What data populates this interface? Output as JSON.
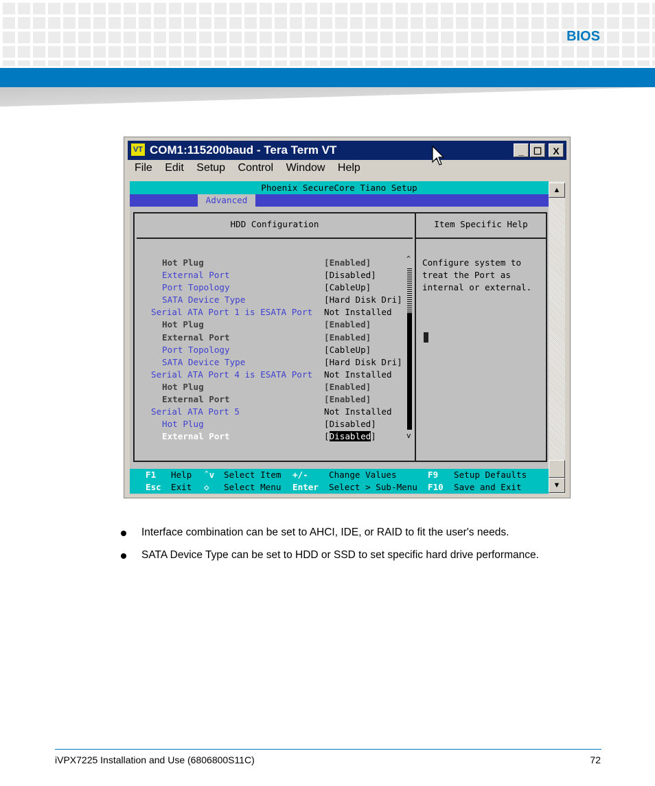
{
  "header": {
    "section": "BIOS"
  },
  "window": {
    "title": "COM1:115200baud - Tera Term VT",
    "icon": "VT",
    "menu": [
      "File",
      "Edit",
      "Setup",
      "Control",
      "Window",
      "Help"
    ],
    "controls": {
      "minimize": "_",
      "maximize": "☐",
      "close": "X"
    }
  },
  "bios": {
    "banner": "Phoenix SecureCore Tiano Setup",
    "tab": "Advanced",
    "panel_title": "HDD Configuration",
    "help_title": "Item Specific Help",
    "help_text": [
      "Configure system to",
      "treat the Port as",
      "internal or external."
    ],
    "rows": [
      {
        "label": "Hot Plug",
        "value": "[Enabled]",
        "style": "gray",
        "indent": true
      },
      {
        "label": "External Port",
        "value": "[Disabled]",
        "style": "blue",
        "indent": true
      },
      {
        "label": "Port Topology",
        "value": "[CableUp]",
        "style": "blue",
        "indent": true
      },
      {
        "label": "SATA Device Type",
        "value": "[Hard Disk Dri]",
        "style": "blue",
        "indent": true
      },
      {
        "label": "Serial ATA Port 1 is ESATA Port",
        "value": "Not Installed",
        "style": "blue",
        "indent": false
      },
      {
        "label": "Hot Plug",
        "value": "[Enabled]",
        "style": "gray",
        "indent": true
      },
      {
        "label": "External Port",
        "value": "[Enabled]",
        "style": "gray",
        "indent": true
      },
      {
        "label": "Port Topology",
        "value": "[CableUp]",
        "style": "blue",
        "indent": true
      },
      {
        "label": "SATA Device Type",
        "value": "[Hard Disk Dri]",
        "style": "blue",
        "indent": true
      },
      {
        "label": "Serial ATA Port 4 is ESATA Port",
        "value": "Not Installed",
        "style": "blue",
        "indent": false
      },
      {
        "label": "Hot Plug",
        "value": "[Enabled]",
        "style": "gray",
        "indent": true
      },
      {
        "label": "External Port",
        "value": "[Enabled]",
        "style": "gray",
        "indent": true
      },
      {
        "label": "Serial ATA Port 5",
        "value": "Not Installed",
        "style": "blue",
        "indent": false
      },
      {
        "label": "Hot Plug",
        "value": "[Disabled]",
        "style": "blue",
        "indent": true
      },
      {
        "label": "External Port",
        "value": "[Disabled]",
        "style": "selected",
        "indent": true
      }
    ],
    "footer": [
      {
        "key": "F1",
        "desc": "Help",
        "key2": "ˆv",
        "desc2": "Select Item",
        "key3": "+/-",
        "desc3": "Change Values",
        "key4": "F9",
        "desc4": "Setup Defaults"
      },
      {
        "key": "Esc",
        "desc": "Exit",
        "key2": "◇",
        "desc2": "Select Menu",
        "key3": "Enter",
        "desc3": "Select > Sub-Menu",
        "key4": "F10",
        "desc4": "Save and Exit"
      }
    ]
  },
  "bullets": [
    "Interface combination can be set to AHCI, IDE, or RAID to fit the user's needs.",
    "SATA Device Type can be set to HDD or SSD to set specific hard drive performance."
  ],
  "footer": {
    "doc": "iVPX7225 Installation and Use (6806800S11C)",
    "page": "72"
  }
}
